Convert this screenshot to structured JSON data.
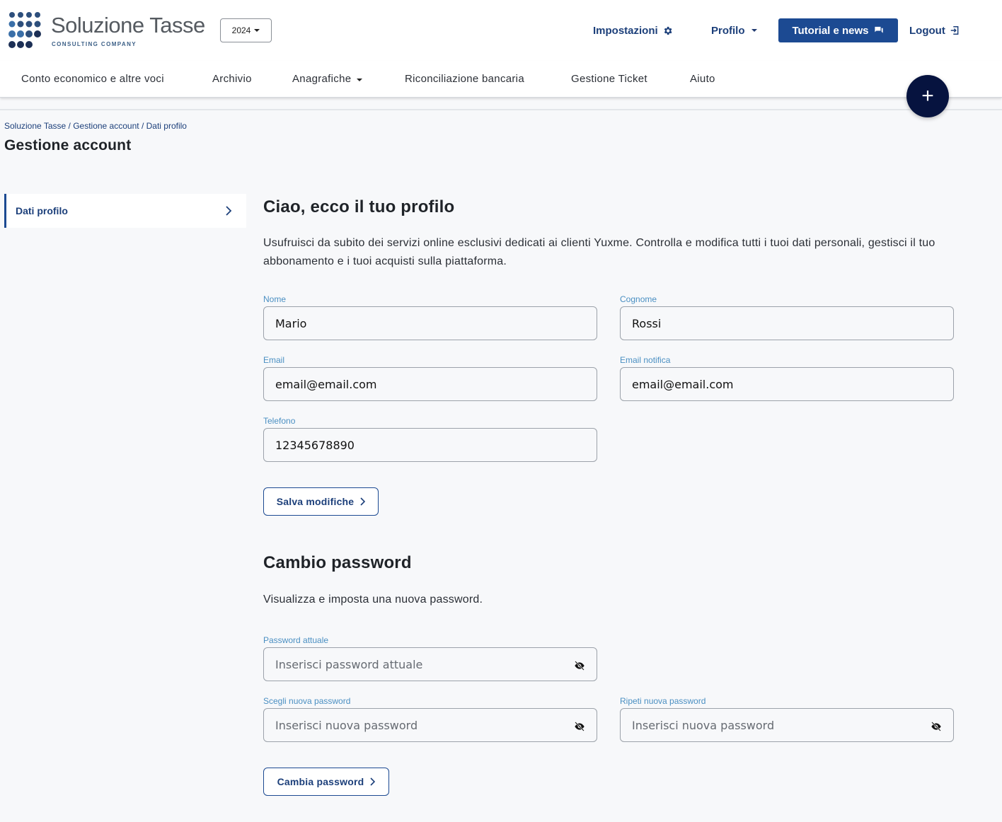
{
  "brand": {
    "name": "Soluzione Tasse",
    "tagline": "CONSULTING COMPANY",
    "dot_colors": [
      "#2d4f7c",
      "#3a6fa8",
      "#1c2f55"
    ]
  },
  "header": {
    "year": "2024",
    "settings_label": "Impostazioni",
    "profile_label": "Profilo",
    "tutorial_label": "Tutorial e news",
    "logout_label": "Logout"
  },
  "nav": {
    "items": [
      {
        "label": "Conto economico e altre voci"
      },
      {
        "label": "Archivio"
      },
      {
        "label": "Anagrafiche"
      },
      {
        "label": "Riconciliazione bancaria"
      },
      {
        "label": "Gestione Ticket"
      },
      {
        "label": "Aiuto"
      }
    ],
    "fab_label": "+"
  },
  "breadcrumb": [
    "Soluzione Tasse",
    "Gestione account",
    "Dati profilo"
  ],
  "page_title": "Gestione account",
  "sidebar": {
    "items": [
      {
        "label": "Dati profilo"
      }
    ]
  },
  "profile": {
    "heading": "Ciao, ecco il tuo profilo",
    "description": "Usufruisci da subito dei servizi online esclusivi dedicati ai clienti Yuxme. Controlla e modifica tutti i tuoi dati personali, gestisci il tuo abbonamento e i tuoi acquisti sulla piattaforma.",
    "fields": {
      "nome": {
        "label": "Nome",
        "value": "Mario"
      },
      "cognome": {
        "label": "Cognome",
        "value": "Rossi"
      },
      "email": {
        "label": "Email",
        "value": "email@email.com"
      },
      "email_notifica": {
        "label": "Email notifica",
        "value": "email@email.com"
      },
      "telefono": {
        "label": "Telefono",
        "value": "12345678890"
      }
    },
    "save_label": "Salva modifiche"
  },
  "password": {
    "heading": "Cambio password",
    "description": "Visualizza e imposta una nuova password.",
    "fields": {
      "current": {
        "label": "Password attuale",
        "placeholder": "Inserisci password attuale"
      },
      "new": {
        "label": "Scegli nuova password",
        "placeholder": "Inserisci nuova password"
      },
      "repeat": {
        "label": "Ripeti nuova password",
        "placeholder": "Inserisci nuova password"
      }
    },
    "change_label": "Cambia password"
  },
  "colors": {
    "primary": "#1c4a92",
    "link": "#1c3f7a",
    "fab": "#06133f",
    "label": "#4a8fc2"
  }
}
